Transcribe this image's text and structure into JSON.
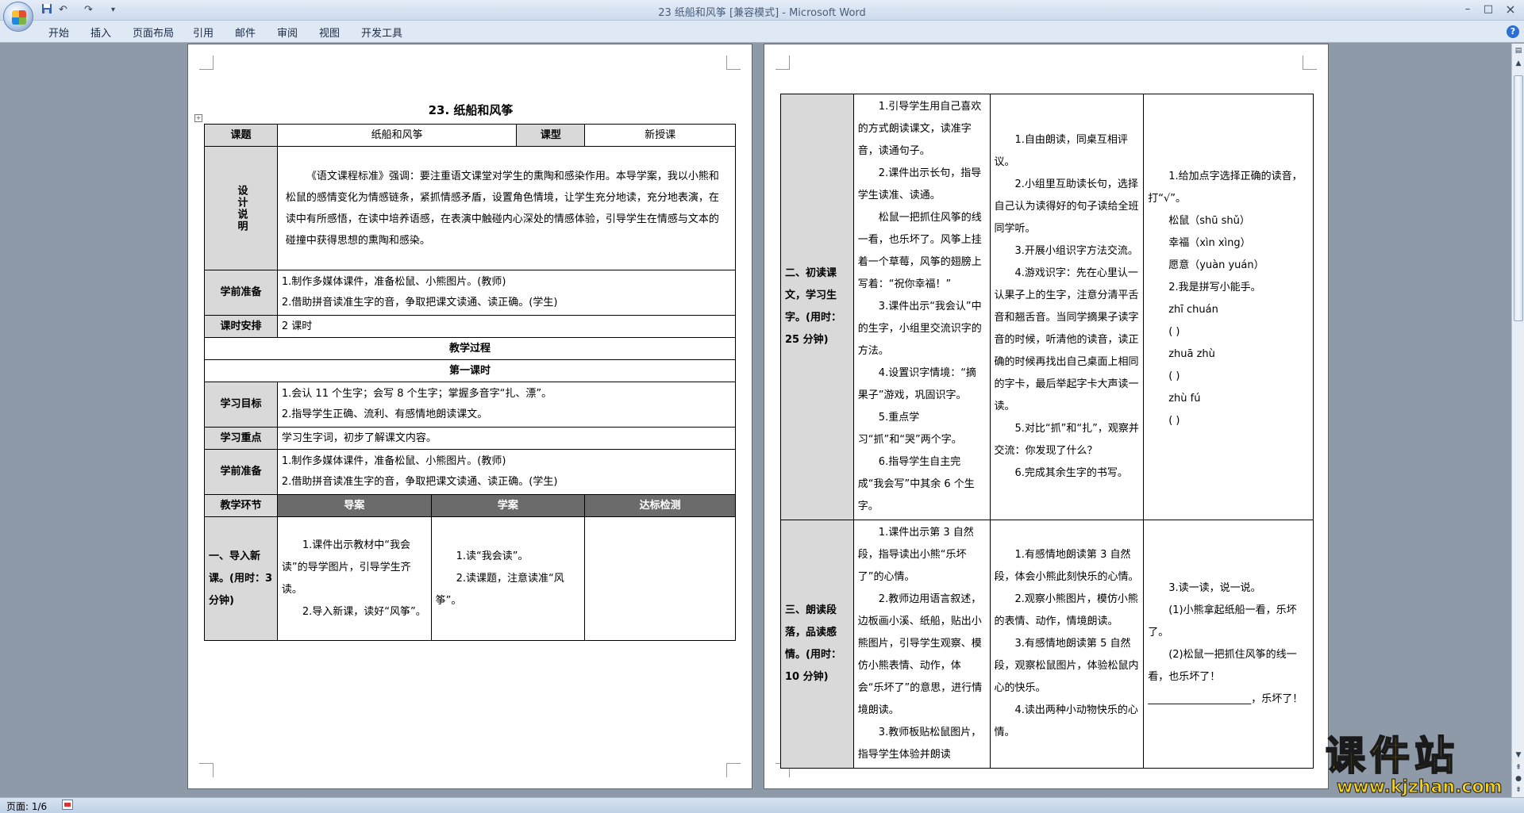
{
  "window": {
    "title": "23 纸船和风筝 [兼容模式] - Microsoft Word",
    "controls": {
      "minimize": "–",
      "maximize": "□",
      "close": "×"
    }
  },
  "qat": {
    "save_icon": "save-icon",
    "undo": "↶",
    "redo": "↷",
    "more": "▾"
  },
  "ribbon": {
    "tabs": [
      "开始",
      "插入",
      "页面布局",
      "引用",
      "邮件",
      "审阅",
      "视图",
      "开发工具"
    ],
    "help": "?"
  },
  "left_page": {
    "title": "23. 纸船和风筝",
    "row_topic": {
      "label": "课题",
      "value": "纸船和风筝",
      "type_label": "课型",
      "type_value": "新授课"
    },
    "design": {
      "label": "设计说明",
      "text": "《语文课程标准》强调：要注重语文课堂对学生的熏陶和感染作用。本导学案，我以小熊和松鼠的感情变化为情感链条，紧抓情感矛盾，设置角色情境，让学生充分地读，充分地表演，在读中有所感悟，在读中培养语感，在表演中触碰内心深处的情感体验，引导学生在情感与文本的碰撞中获得思想的熏陶和感染。"
    },
    "prep1": {
      "label": "学前准备",
      "line1": "1.制作多媒体课件，准备松鼠、小熊图片。(教师)",
      "line2": "2.借助拼音读准生字的音，争取把课文读通、读正确。(学生)"
    },
    "schedule": {
      "label": "课时安排",
      "value": "2 课时"
    },
    "process_header": "教学过程",
    "period_header": "第一课时",
    "goals": {
      "label": "学习目标",
      "line1": "1.会认 11 个生字；会写 8 个生字；掌握多音字“扎、漂”。",
      "line2": "2.指导学生正确、流利、有感情地朗读课文。"
    },
    "focus": {
      "label": "学习重点",
      "value": "学习生字词，初步了解课文内容。"
    },
    "prep2": {
      "label": "学前准备",
      "line1": "1.制作多媒体课件，准备松鼠、小熊图片。(教师)",
      "line2": "2.借助拼音读准生字的音，争取把课文读通、读正确。(学生)"
    },
    "step_header": {
      "c1": "教学环节",
      "c2": "导案",
      "c3": "学案",
      "c4": "达标检测"
    },
    "step1": {
      "stage": "一、导入新课。(用时：3 分钟)",
      "guide1": "1.课件出示教材中“我会读”的导学图片，引导学生齐读。",
      "guide2": "2.导入新课，读好“风筝”。",
      "study1": "1.读“我会读”。",
      "study2": "2.读课题，注意读准“风筝”。",
      "check": ""
    }
  },
  "right_page": {
    "row2": {
      "stage": "二、初读课文，学习生字。(用时：25 分钟)",
      "guide": [
        "1.引导学生用自己喜欢的方式朗读课文，读准字音，读通句子。",
        "2.课件出示长句，指导学生读准、读通。",
        "松鼠一把抓住风筝的线一看，也乐坏了。风筝上挂着一个草莓，风筝的翅膀上写着：“祝你幸福！”",
        "3.课件出示“我会认”中的生字，小组里交流识字的方法。",
        "4.设置识字情境：“摘果子”游戏，巩固识字。",
        "5.重点学习“抓”和“哭”两个字。",
        "6.指导学生自主完成“我会写”中其余 6 个生字。"
      ],
      "study": [
        "1.自由朗读，同桌互相评议。",
        "2.小组里互助读长句，选择自己认为读得好的句子读给全班同学听。",
        "3.开展小组识字方法交流。",
        "4.游戏识字：先在心里认一认果子上的生字，注意分清平舌音和翘舌音。当同学摘果子读字音的时候，听清他的读音，读正确的时候再找出自己桌面上相同的字卡，最后举起字卡大声读一读。",
        "5.对比“抓”和“扎”，观察并交流：你发现了什么？",
        "6.完成其余生字的书写。"
      ],
      "check": [
        "1.给加点字选择正确的读音，打“√”。",
        "松鼠（shū shǔ）",
        "幸福（xìn xìng）",
        "愿意（yuàn yuán）",
        "2.我是拼写小能手。",
        "zhī chuán",
        "(          )",
        "zhuā zhù",
        "(          )",
        "zhù fú",
        "(          )"
      ]
    },
    "row3": {
      "stage": "三、朗读段落，品读感情。(用时：10 分钟)",
      "guide": [
        "1.课件出示第 3 自然段，指导读出小熊“乐坏了”的心情。",
        "2.教师边用语言叙述，边板画小溪、纸船，贴出小熊图片，引导学生观察、模仿小熊表情、动作，体会“乐坏了”的意思，进行情境朗读。",
        "3.教师板贴松鼠图片，指导学生体验并朗读"
      ],
      "study": [
        "1.有感情地朗读第 3 自然段，体会小熊此刻快乐的心情。",
        "2.观察小熊图片，模仿小熊的表情、动作，情境朗读。",
        "3.有感情地朗读第 5 自然段，观察松鼠图片，体验松鼠内心的快乐。",
        "4.读出两种小动物快乐的心情。"
      ],
      "check": [
        "3.读一读，说一说。",
        "(1)小熊拿起纸船一看，乐坏了。",
        "(2)松鼠一把抓住风筝的线一看，也乐坏了！",
        "____________________，乐坏了！"
      ]
    }
  },
  "statusbar": {
    "page": "页面: 1/6"
  },
  "watermark": {
    "main": "课件站",
    "url": "www.kjzhan.com"
  }
}
